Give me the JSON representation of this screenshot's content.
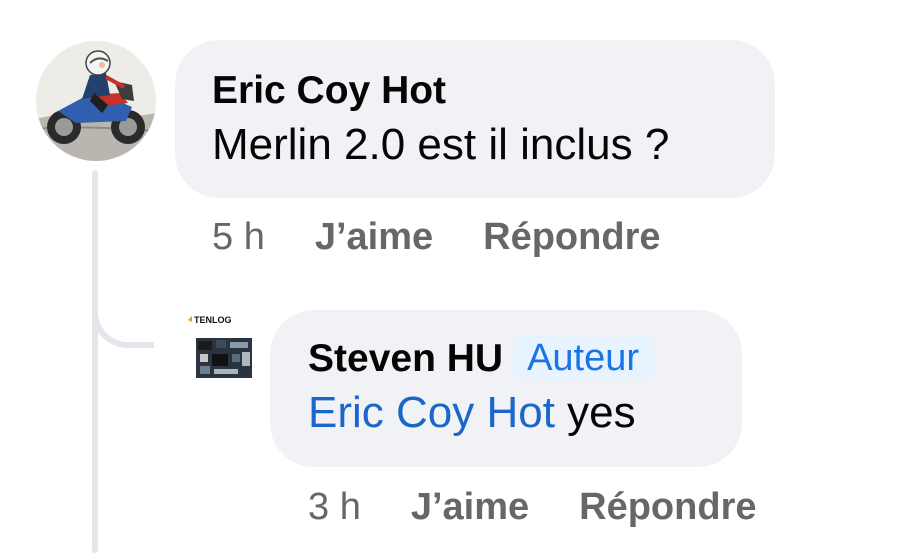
{
  "comment": {
    "author": "Eric Coy Hot",
    "text": "Merlin 2.0 est il inclus ?",
    "time": "5 h",
    "like_label": "J’aime",
    "reply_label": "Répondre",
    "avatar_icon": "motorcycle-rider-avatar-icon"
  },
  "reply": {
    "author": "Steven HU",
    "badge": "Auteur",
    "mention": "Eric Coy Hot",
    "text": " yes",
    "time": "3 h",
    "like_label": "J’aime",
    "reply_label": "Répondre",
    "avatar_logo_text": "TENLOG",
    "avatar_icon": "circuit-board-avatar-icon"
  },
  "colors": {
    "bubble": "#f0f2f5",
    "thread_line": "#e4e6eb",
    "secondary_text": "#65676b",
    "mention": "#1b66c9",
    "badge_bg": "#e7f3ff",
    "badge_text": "#1b74e4"
  }
}
